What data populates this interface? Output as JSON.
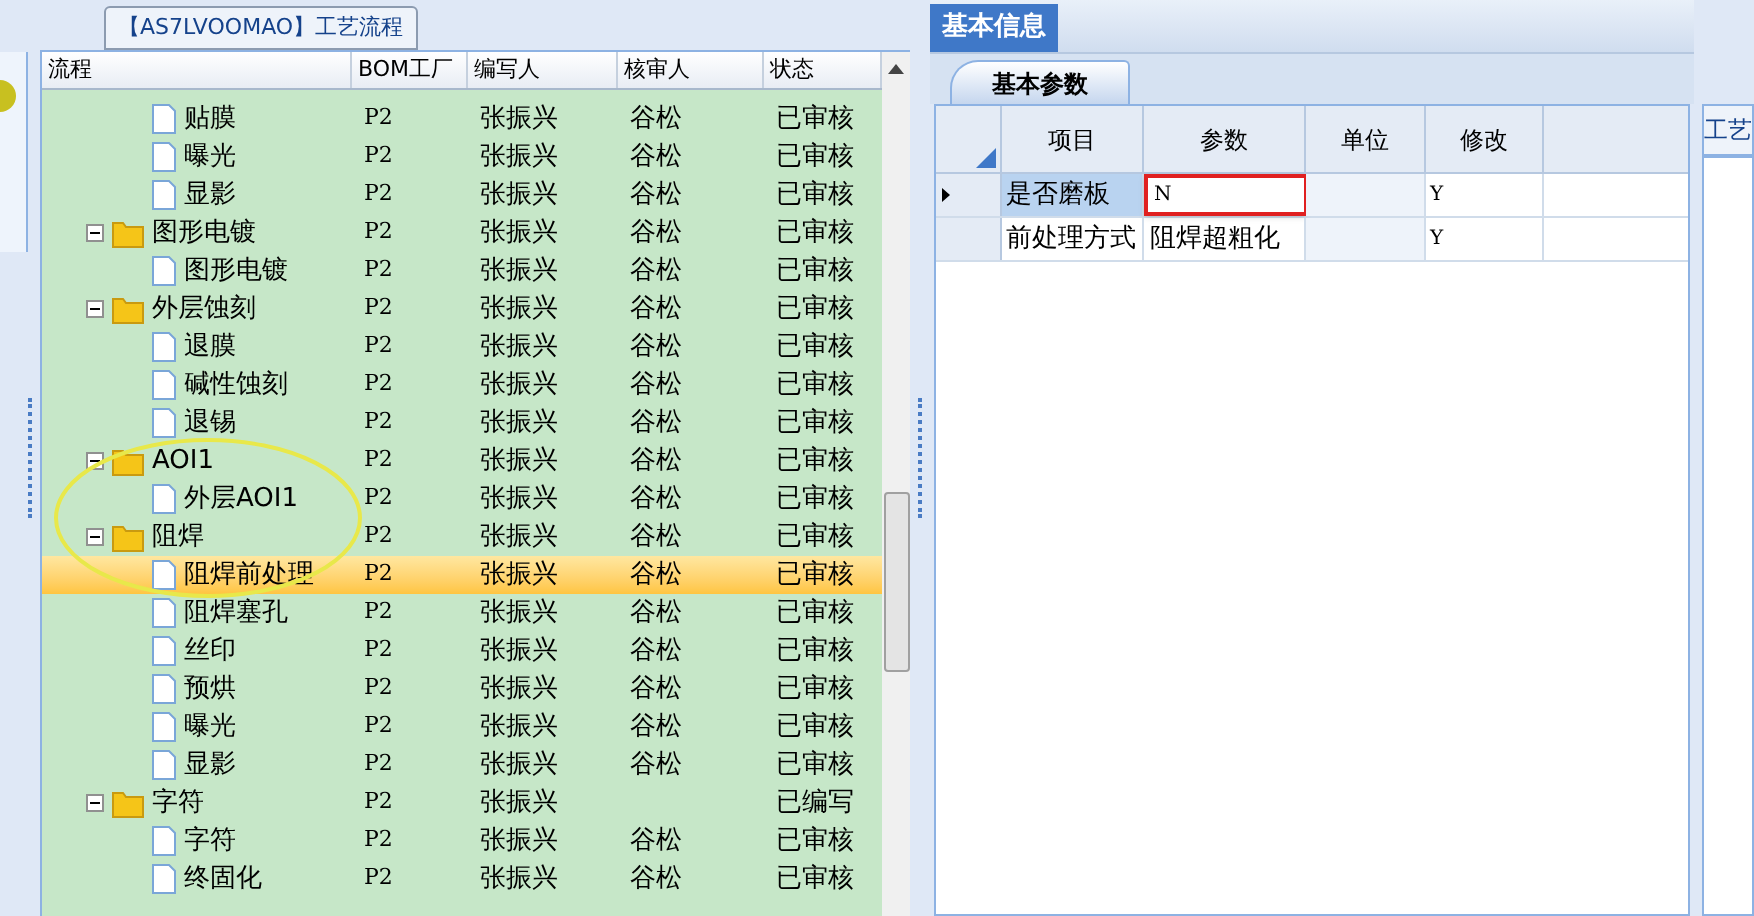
{
  "process_tab": {
    "title": "【AS7LVOOMAO】工艺流程"
  },
  "tree_table": {
    "columns": [
      "流程",
      "BOM工厂",
      "编写人",
      "核审人",
      "状态"
    ],
    "rows": [
      {
        "kind": "file",
        "name": "贴膜",
        "factory": "P2",
        "author": "张振兴",
        "reviewer": "谷松",
        "status": "已审核",
        "selected": false
      },
      {
        "kind": "file",
        "name": "曝光",
        "factory": "P2",
        "author": "张振兴",
        "reviewer": "谷松",
        "status": "已审核",
        "selected": false
      },
      {
        "kind": "file",
        "name": "显影",
        "factory": "P2",
        "author": "张振兴",
        "reviewer": "谷松",
        "status": "已审核",
        "selected": false
      },
      {
        "kind": "folder",
        "name": "图形电镀",
        "factory": "P2",
        "author": "张振兴",
        "reviewer": "谷松",
        "status": "已审核",
        "selected": false,
        "expanded": true,
        "children": [
          {
            "kind": "file",
            "name": "图形电镀",
            "factory": "P2",
            "author": "张振兴",
            "reviewer": "谷松",
            "status": "已审核",
            "selected": false
          }
        ]
      },
      {
        "kind": "folder",
        "name": "外层蚀刻",
        "factory": "P2",
        "author": "张振兴",
        "reviewer": "谷松",
        "status": "已审核",
        "selected": false,
        "expanded": true,
        "children": [
          {
            "kind": "file",
            "name": "退膜",
            "factory": "P2",
            "author": "张振兴",
            "reviewer": "谷松",
            "status": "已审核",
            "selected": false
          },
          {
            "kind": "file",
            "name": "碱性蚀刻",
            "factory": "P2",
            "author": "张振兴",
            "reviewer": "谷松",
            "status": "已审核",
            "selected": false
          },
          {
            "kind": "file",
            "name": "退锡",
            "factory": "P2",
            "author": "张振兴",
            "reviewer": "谷松",
            "status": "已审核",
            "selected": false
          }
        ]
      },
      {
        "kind": "folder",
        "name": "AOI1",
        "factory": "P2",
        "author": "张振兴",
        "reviewer": "谷松",
        "status": "已审核",
        "selected": false,
        "expanded": true,
        "children": [
          {
            "kind": "file",
            "name": "外层AOI1",
            "factory": "P2",
            "author": "张振兴",
            "reviewer": "谷松",
            "status": "已审核",
            "selected": false
          }
        ]
      },
      {
        "kind": "folder",
        "name": "阻焊",
        "factory": "P2",
        "author": "张振兴",
        "reviewer": "谷松",
        "status": "已审核",
        "selected": false,
        "expanded": true,
        "children": [
          {
            "kind": "file",
            "name": "阻焊前处理",
            "factory": "P2",
            "author": "张振兴",
            "reviewer": "谷松",
            "status": "已审核",
            "selected": true
          },
          {
            "kind": "file",
            "name": "阻焊塞孔",
            "factory": "P2",
            "author": "张振兴",
            "reviewer": "谷松",
            "status": "已审核",
            "selected": false
          },
          {
            "kind": "file",
            "name": "丝印",
            "factory": "P2",
            "author": "张振兴",
            "reviewer": "谷松",
            "status": "已审核",
            "selected": false
          },
          {
            "kind": "file",
            "name": "预烘",
            "factory": "P2",
            "author": "张振兴",
            "reviewer": "谷松",
            "status": "已审核",
            "selected": false
          },
          {
            "kind": "file",
            "name": "曝光",
            "factory": "P2",
            "author": "张振兴",
            "reviewer": "谷松",
            "status": "已审核",
            "selected": false
          },
          {
            "kind": "file",
            "name": "显影",
            "factory": "P2",
            "author": "张振兴",
            "reviewer": "谷松",
            "status": "已审核",
            "selected": false
          }
        ]
      },
      {
        "kind": "folder",
        "name": "字符",
        "factory": "P2",
        "author": "张振兴",
        "status": "已编写",
        "selected": false,
        "expanded": true,
        "children": [
          {
            "kind": "file",
            "name": "字符",
            "factory": "P2",
            "author": "张振兴",
            "reviewer": "谷松",
            "status": "已审核",
            "selected": false
          },
          {
            "kind": "file",
            "name": "终固化",
            "factory": "P2",
            "author": "张振兴",
            "reviewer": "谷松",
            "status": "已审核",
            "selected": false
          }
        ]
      }
    ]
  },
  "info_tab": {
    "title": "基本信息",
    "selected": true
  },
  "param_tab": {
    "title": "基本参数",
    "selected": true
  },
  "param_grid": {
    "columns": [
      "项目",
      "参数",
      "单位",
      "修改"
    ],
    "rows": [
      {
        "item": "是否磨板",
        "value": "N",
        "modify": "Y",
        "current": true,
        "highlighted": true
      },
      {
        "item": "前处理方式",
        "value": "阻焊超粗化",
        "modify": "Y",
        "current": false,
        "highlighted": false
      }
    ]
  },
  "side_panel": {
    "label": "工艺"
  }
}
